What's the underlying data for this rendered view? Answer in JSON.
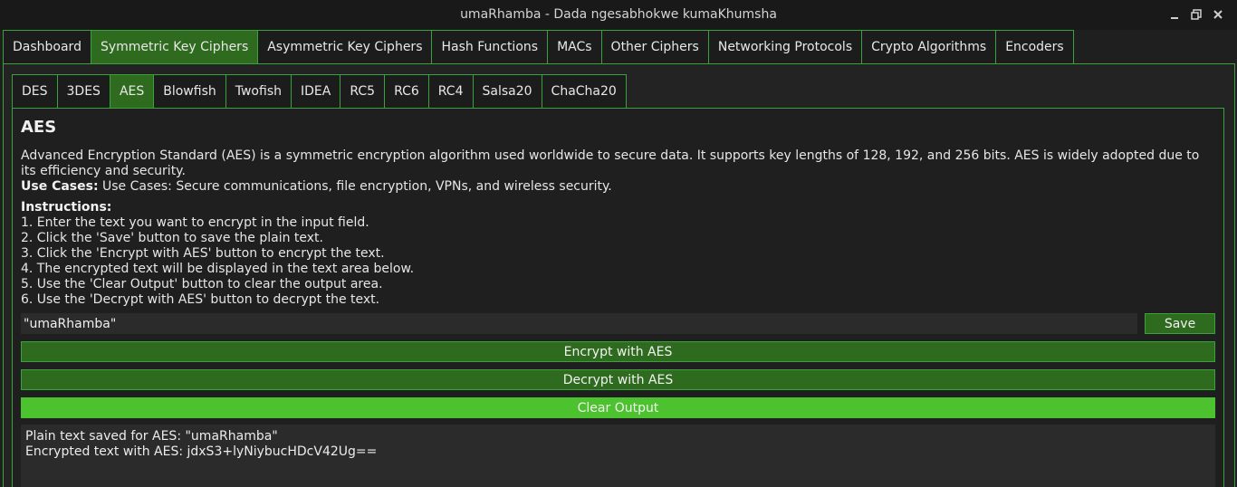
{
  "window": {
    "title": "umaRhamba - Dada ngesabhokwe kumaKhumsha"
  },
  "main_tabs": [
    {
      "label": "Dashboard",
      "active": false
    },
    {
      "label": "Symmetric Key Ciphers",
      "active": true
    },
    {
      "label": "Asymmetric Key Ciphers",
      "active": false
    },
    {
      "label": "Hash Functions",
      "active": false
    },
    {
      "label": "MACs",
      "active": false
    },
    {
      "label": "Other Ciphers",
      "active": false
    },
    {
      "label": "Networking Protocols",
      "active": false
    },
    {
      "label": "Crypto Algorithms",
      "active": false
    },
    {
      "label": "Encoders",
      "active": false
    }
  ],
  "sub_tabs": [
    {
      "label": "DES",
      "active": false
    },
    {
      "label": "3DES",
      "active": false
    },
    {
      "label": "AES",
      "active": true
    },
    {
      "label": "Blowfish",
      "active": false
    },
    {
      "label": "Twofish",
      "active": false
    },
    {
      "label": "IDEA",
      "active": false
    },
    {
      "label": "RC5",
      "active": false
    },
    {
      "label": "RC6",
      "active": false
    },
    {
      "label": "RC4",
      "active": false
    },
    {
      "label": "Salsa20",
      "active": false
    },
    {
      "label": "ChaCha20",
      "active": false
    }
  ],
  "content": {
    "heading": "AES",
    "description": "Advanced Encryption Standard (AES) is a symmetric encryption algorithm used worldwide to secure data. It supports key lengths of 128, 192, and 256 bits. AES is widely adopted due to its efficiency and security.",
    "use_cases_label": "Use Cases:",
    "use_cases_text": " Use Cases: Secure communications, file encryption, VPNs, and wireless security.",
    "instructions_label": "Instructions:",
    "instructions": [
      "1. Enter the text you want to encrypt in the input field.",
      "2. Click the 'Save' button to save the plain text.",
      "3. Click the 'Encrypt with AES' button to encrypt the text.",
      "4. The encrypted text will be displayed in the text area below.",
      "5. Use the 'Clear Output' button to clear the output area.",
      "6. Use the 'Decrypt with AES' button to decrypt the text."
    ]
  },
  "input": {
    "value": "\"umaRhamba\""
  },
  "buttons": {
    "save": "Save",
    "encrypt": "Encrypt with AES",
    "decrypt": "Decrypt with AES",
    "clear": "Clear Output"
  },
  "output": {
    "lines": [
      "Plain text saved for AES: \"umaRhamba\"",
      "Encrypted text with AES: jdxS3+lyNiybucHDcV42Ug=="
    ]
  },
  "colors": {
    "accent": "#3aa23a",
    "active_tab": "#2f6b1f",
    "clear_button": "#4cc22e",
    "background": "#1f1f1f"
  }
}
